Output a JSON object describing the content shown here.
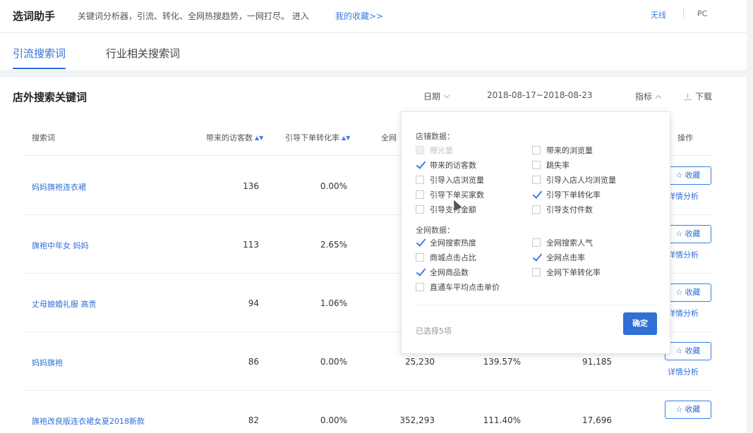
{
  "header": {
    "title": "选词助手",
    "desc": "关键词分析器，引流、转化、全网热搜趋势，一网打尽。 进入",
    "fav_link": "我的收藏>>",
    "wireless": "无线",
    "pc": "PC"
  },
  "tabs": [
    {
      "label": "引流搜索词"
    },
    {
      "label": "行业相关搜索词"
    }
  ],
  "section": {
    "title": "店外搜索关键词",
    "date_label": "日期",
    "date_range": "2018-08-17~2018-08-23",
    "metric_label": "指标",
    "download_label": "下载"
  },
  "table": {
    "headers": {
      "keyword": "搜索词",
      "visitors": "带来的访客数",
      "conversion": "引导下单转化率",
      "global": "全网",
      "action": "操作"
    },
    "rows": [
      {
        "keyword": "妈妈旗袍连衣裙",
        "visitors": "136",
        "conversion": "0.00%",
        "c3": "",
        "c4": "",
        "c5": ""
      },
      {
        "keyword": "旗袍中年女 妈妈",
        "visitors": "113",
        "conversion": "2.65%",
        "c3": "",
        "c4": "",
        "c5": ""
      },
      {
        "keyword": "丈母娘婚礼服 高贵",
        "visitors": "94",
        "conversion": "1.06%",
        "c3": "",
        "c4": "",
        "c5": ""
      },
      {
        "keyword": "妈妈旗袍",
        "visitors": "86",
        "conversion": "0.00%",
        "c3": "25,230",
        "c4": "139.57%",
        "c5": "91,185"
      },
      {
        "keyword": "旗袍改良版连衣裙女夏2018新款",
        "visitors": "82",
        "conversion": "0.00%",
        "c3": "352,293",
        "c4": "111.40%",
        "c5": "17,696"
      }
    ],
    "fav_button": "收藏",
    "detail_link": "详情分析"
  },
  "metrics_dropdown": {
    "shop_section": "店铺数据：",
    "global_section": "全网数据：",
    "shop_options": [
      {
        "label": "曝光量",
        "checked": false,
        "disabled": true
      },
      {
        "label": "带来的浏览量",
        "checked": false,
        "disabled": false
      },
      {
        "label": "带来的访客数",
        "checked": true,
        "disabled": false
      },
      {
        "label": "跳失率",
        "checked": false,
        "disabled": false
      },
      {
        "label": "引导入店浏览量",
        "checked": false,
        "disabled": false
      },
      {
        "label": "引导入店人均浏览量",
        "checked": false,
        "disabled": false
      },
      {
        "label": "引导下单买家数",
        "checked": false,
        "disabled": false
      },
      {
        "label": "引导下单转化率",
        "checked": true,
        "disabled": false
      },
      {
        "label": "引导支付金额",
        "checked": false,
        "disabled": false
      },
      {
        "label": "引导支付件数",
        "checked": false,
        "disabled": false
      }
    ],
    "global_options": [
      {
        "label": "全网搜索热度",
        "checked": true
      },
      {
        "label": "全网搜索人气",
        "checked": false
      },
      {
        "label": "商城点击占比",
        "checked": false
      },
      {
        "label": "全网点击率",
        "checked": true
      },
      {
        "label": "全网商品数",
        "checked": true
      },
      {
        "label": "全网下单转化率",
        "checked": false
      },
      {
        "label": "直通车平均点击单价",
        "checked": false
      }
    ],
    "selected_count": "已选择5项",
    "confirm": "确定"
  }
}
